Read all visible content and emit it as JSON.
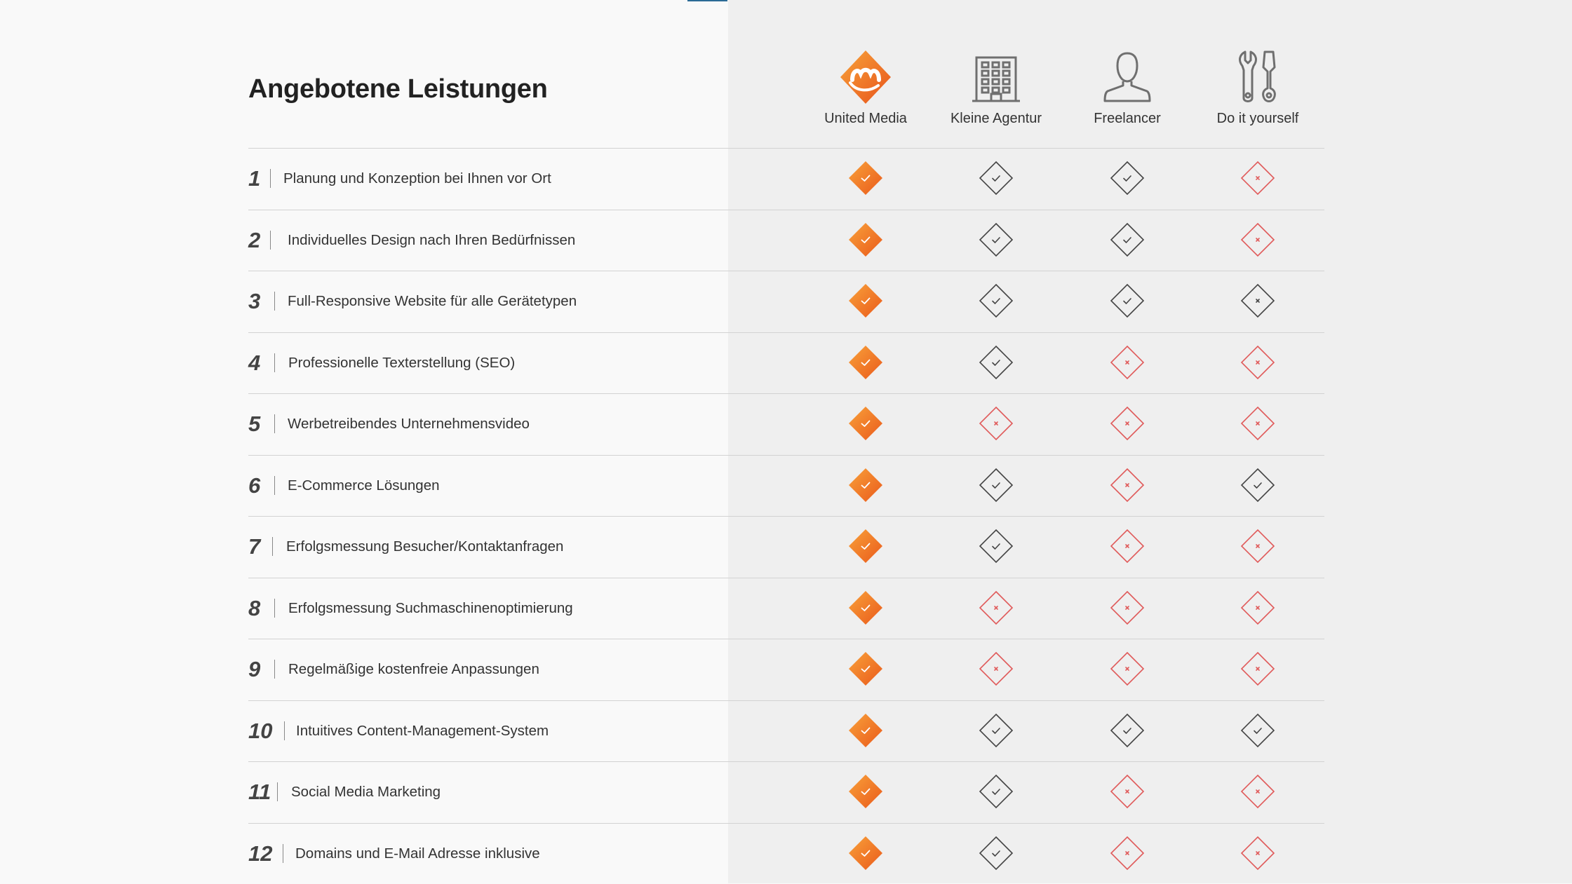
{
  "section": {
    "title": "Angebotene Leistungen"
  },
  "columns": [
    {
      "label": "United Media",
      "icon": "united-media-logo-icon"
    },
    {
      "label": "Kleine Agentur",
      "icon": "office-building-icon"
    },
    {
      "label": "Freelancer",
      "icon": "person-icon"
    },
    {
      "label": "Do it yourself",
      "icon": "tools-icon"
    }
  ],
  "rows": [
    {
      "number": "1",
      "label": "Planung und Konzeption bei Ihnen vor Ort",
      "values": [
        "featured",
        "check",
        "check",
        "cross"
      ]
    },
    {
      "number": "2",
      "label": "Individuelles Design nach Ihren Bedürfnissen",
      "values": [
        "featured",
        "check",
        "check",
        "cross"
      ]
    },
    {
      "number": "3",
      "label": "Full-Responsive Website für alle Gerätetypen",
      "values": [
        "featured",
        "check",
        "check",
        "cross-neutral"
      ]
    },
    {
      "number": "4",
      "label": "Professionelle Texterstellung (SEO)",
      "values": [
        "featured",
        "check",
        "cross",
        "cross"
      ]
    },
    {
      "number": "5",
      "label": "Werbetreibendes Unternehmensvideo",
      "values": [
        "featured",
        "cross",
        "cross",
        "cross"
      ]
    },
    {
      "number": "6",
      "label": "E-Commerce Lösungen",
      "values": [
        "featured",
        "check",
        "cross",
        "check"
      ]
    },
    {
      "number": "7",
      "label": "Erfolgsmessung Besucher/Kontaktanfragen",
      "values": [
        "featured",
        "check",
        "cross",
        "cross"
      ]
    },
    {
      "number": "8",
      "label": "Erfolgsmessung Suchmaschinenoptimierung",
      "values": [
        "featured",
        "cross",
        "cross",
        "cross"
      ]
    },
    {
      "number": "9",
      "label": "Regelmäßige kostenfreie Anpassungen",
      "values": [
        "featured",
        "cross",
        "cross",
        "cross"
      ]
    },
    {
      "number": "10",
      "label": "Intuitives Content-Management-System",
      "values": [
        "featured",
        "check",
        "check",
        "check"
      ]
    },
    {
      "number": "11",
      "label": "Social Media Marketing",
      "values": [
        "featured",
        "check",
        "cross",
        "cross"
      ]
    },
    {
      "number": "12",
      "label": "Domains und E-Mail Adresse inklusive",
      "values": [
        "featured",
        "check",
        "cross",
        "cross"
      ]
    }
  ],
  "colors": {
    "accent_orange": "#f07c1e",
    "check_stroke": "#444444",
    "cross_red": "#e05a5a",
    "top_accent": "#2b6a95"
  }
}
